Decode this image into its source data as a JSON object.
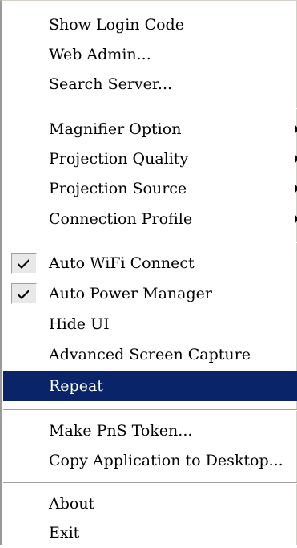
{
  "menu": {
    "group1": [
      {
        "label": "Show Login Code"
      },
      {
        "label": "Web Admin..."
      },
      {
        "label": "Search Server..."
      }
    ],
    "group2": [
      {
        "label": "Magnifier Option",
        "submenu": true
      },
      {
        "label": "Projection Quality",
        "submenu": true
      },
      {
        "label": "Projection Source",
        "submenu": true
      },
      {
        "label": "Connection Profile",
        "submenu": true
      }
    ],
    "group3": [
      {
        "label": "Auto WiFi Connect",
        "checked": true
      },
      {
        "label": "Auto Power Manager",
        "checked": true
      },
      {
        "label": "Hide UI"
      },
      {
        "label": "Advanced Screen Capture"
      },
      {
        "label": "Repeat",
        "highlighted": true
      }
    ],
    "group4": [
      {
        "label": "Make PnS Token..."
      },
      {
        "label": "Copy Application to Desktop..."
      }
    ],
    "group5": [
      {
        "label": "About"
      },
      {
        "label": "Exit"
      }
    ]
  },
  "colors": {
    "highlight_bg": "#0a246a",
    "highlight_text": "#ffffff"
  },
  "icons": {
    "check": "check-icon",
    "submenu": "submenu-arrow-icon"
  }
}
